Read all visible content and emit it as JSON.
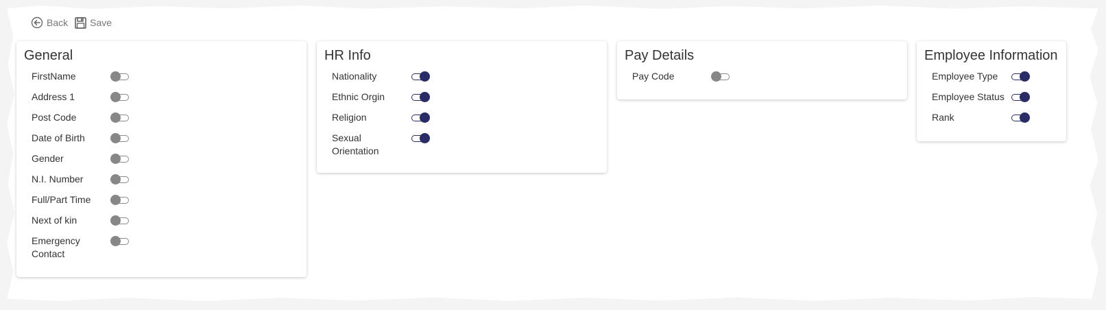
{
  "toolbar": {
    "back_label": "Back",
    "save_label": "Save"
  },
  "colors": {
    "toggle_on": "#2a2c65",
    "toggle_off": "#878787"
  },
  "cards": {
    "general": {
      "title": "General",
      "fields": [
        {
          "label": "FirstName",
          "enabled": false
        },
        {
          "label": "Address 1",
          "enabled": false
        },
        {
          "label": "Post Code",
          "enabled": false
        },
        {
          "label": "Date of Birth",
          "enabled": false
        },
        {
          "label": "Gender",
          "enabled": false
        },
        {
          "label": "N.I. Number",
          "enabled": false
        },
        {
          "label": "Full/Part Time",
          "enabled": false
        },
        {
          "label": "Next of kin",
          "enabled": false
        },
        {
          "label": "Emergency Contact",
          "enabled": false
        }
      ]
    },
    "hr_info": {
      "title": "HR Info",
      "fields": [
        {
          "label": "Nationality",
          "enabled": true
        },
        {
          "label": "Ethnic Orgin",
          "enabled": true
        },
        {
          "label": "Religion",
          "enabled": true
        },
        {
          "label": "Sexual Orientation",
          "enabled": true
        }
      ]
    },
    "pay_details": {
      "title": "Pay Details",
      "fields": [
        {
          "label": "Pay Code",
          "enabled": false
        }
      ]
    },
    "employee_information": {
      "title": "Employee Information",
      "fields": [
        {
          "label": "Employee Type",
          "enabled": true
        },
        {
          "label": "Employee Status",
          "enabled": true
        },
        {
          "label": "Rank",
          "enabled": true
        }
      ]
    }
  }
}
